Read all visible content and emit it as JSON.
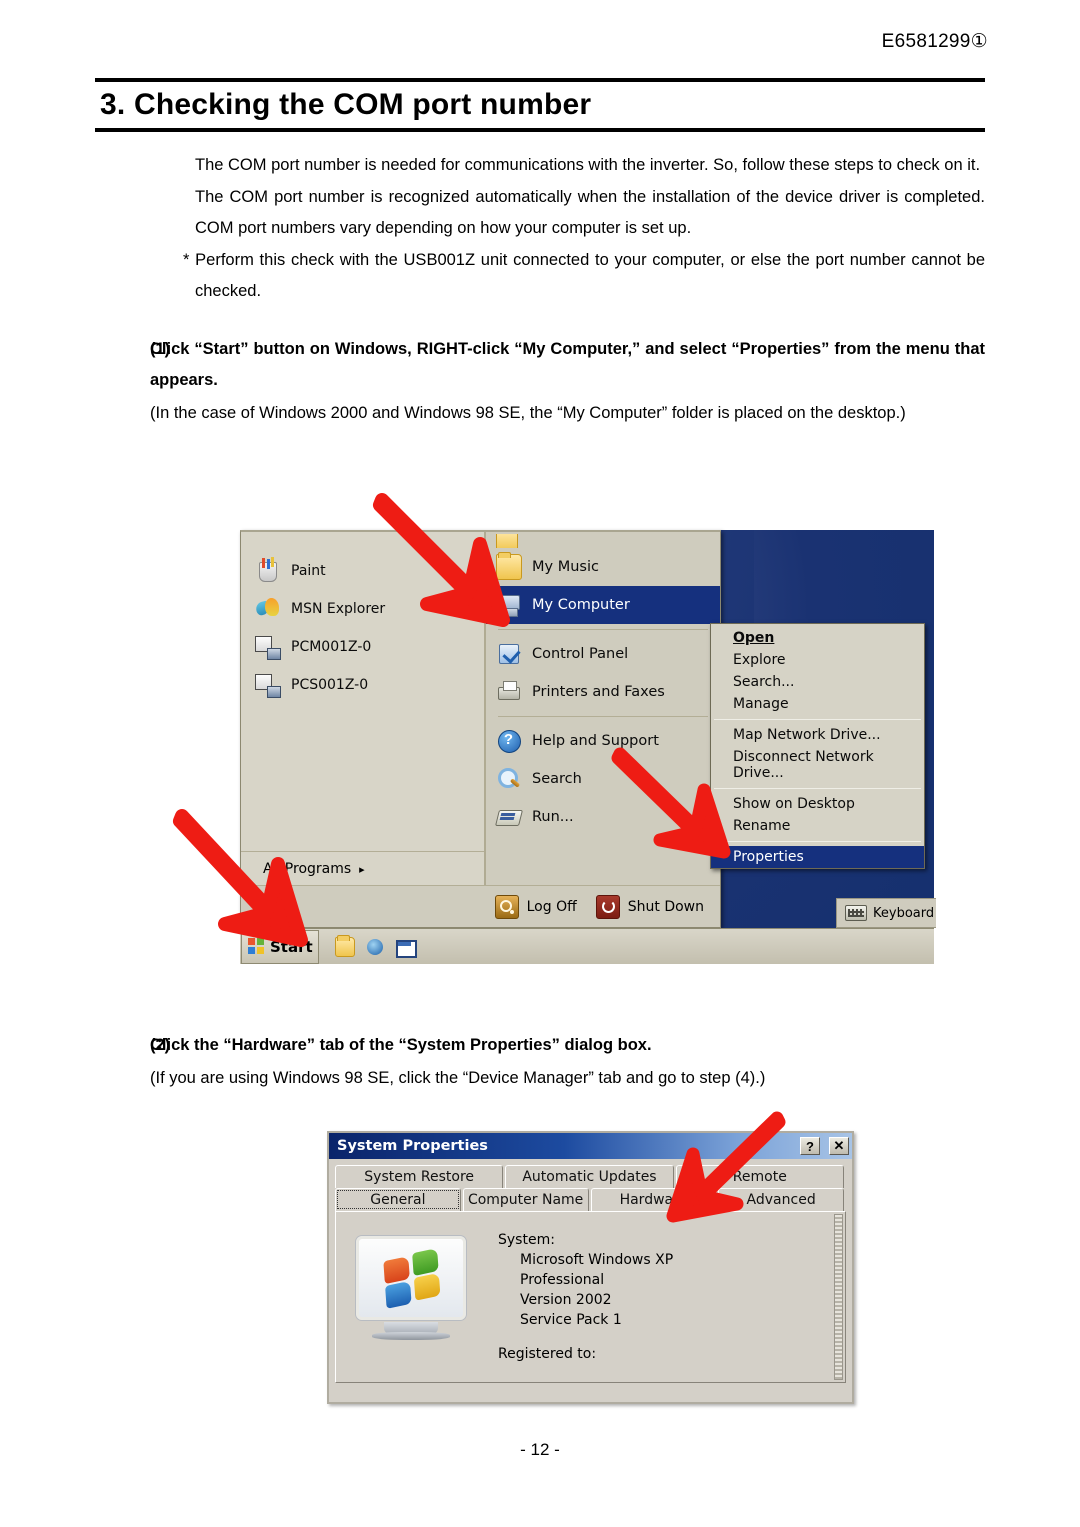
{
  "document": {
    "code": "E6581299①",
    "title": "3. Checking the COM port number",
    "page_number": "- 12 -",
    "intro": [
      "The COM port number is needed for communications with the inverter. So, follow these steps to check on it.",
      "The COM port number is recognized automatically when the installation of the device driver is completed. COM port numbers vary depending on how your computer is set up."
    ],
    "note": "* Perform this check with the USB001Z unit connected to your computer, or else the port number cannot be checked."
  },
  "steps": [
    {
      "number": "(1)",
      "bold": "Click “Start” button on Windows, RIGHT-click “My Computer,” and select “Properties” from the menu that appears.",
      "sub": "(In the case of Windows 2000 and Windows 98 SE, the “My Computer” folder is placed on the desktop.)"
    },
    {
      "number": "(2)",
      "bold": "Click the “Hardware” tab of the “System Properties” dialog box.",
      "sub": "(If you are using Windows 98 SE, click the “Device Manager” tab and go to step (4).)"
    }
  ],
  "figure_start_menu": {
    "left_items": [
      {
        "label": "Paint",
        "icon": "paint-icon"
      },
      {
        "label": "MSN Explorer",
        "icon": "msn-explorer-icon"
      },
      {
        "label": "PCM001Z-0",
        "icon": "device-icon"
      },
      {
        "label": "PCS001Z-0",
        "icon": "device-icon"
      }
    ],
    "all_programs": "All Programs",
    "all_programs_arrow": "▸",
    "right_items": [
      {
        "label": "My Music",
        "icon": "folder-icon",
        "selected": false
      },
      {
        "label": "My Computer",
        "icon": "my-computer-icon",
        "selected": true
      },
      {
        "label": "Control Panel",
        "icon": "control-panel-icon",
        "selected": false
      },
      {
        "label": "Printers and Faxes",
        "icon": "printer-icon",
        "selected": false
      },
      {
        "label": "Help and Support",
        "icon": "help-icon",
        "selected": false
      },
      {
        "label": "Search",
        "icon": "search-icon",
        "selected": false
      },
      {
        "label": "Run...",
        "icon": "run-icon",
        "selected": false
      }
    ],
    "log_off": "Log Off",
    "shut_down": "Shut Down",
    "context_menu": [
      {
        "label": "Open",
        "style": "bold"
      },
      {
        "label": "Explore",
        "style": "normal"
      },
      {
        "label": "Search...",
        "style": "normal"
      },
      {
        "label": "Manage",
        "style": "normal"
      },
      {
        "label": "Map Network Drive...",
        "style": "normal"
      },
      {
        "label": "Disconnect Network Drive...",
        "style": "normal"
      },
      {
        "label": "Show on Desktop",
        "style": "normal"
      },
      {
        "label": "Rename",
        "style": "normal"
      },
      {
        "label": "Properties",
        "style": "selected"
      }
    ],
    "taskbar": {
      "start_label": "Start",
      "toolbar_label": "Keyboard"
    }
  },
  "figure_system_properties": {
    "window_title": "System Properties",
    "help_button": "?",
    "close_button": "✕",
    "tabs_row1": [
      "System Restore",
      "Automatic Updates",
      "Remote"
    ],
    "tabs_row2": [
      "General",
      "Computer Name",
      "Hardware",
      "Advanced"
    ],
    "active_tab": "General",
    "system_label": "System:",
    "system_lines": [
      "Microsoft Windows XP",
      "Professional",
      "Version 2002",
      "Service Pack 1"
    ],
    "registered_label": "Registered to:"
  },
  "colors": {
    "arrow_red": "#ee1c14",
    "selection_blue": "#15307e",
    "title_bar_blue": "#0a246a",
    "dialog_face": "#d4d0c8"
  }
}
